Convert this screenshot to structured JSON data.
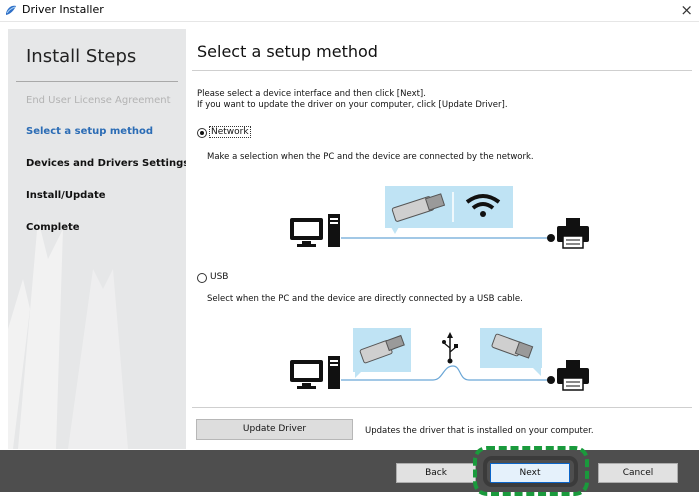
{
  "window": {
    "title": "Driver Installer",
    "close_glyph": "×"
  },
  "sidebar": {
    "heading": "Install Steps",
    "steps": [
      {
        "label": "End User License Agreement",
        "state": "done"
      },
      {
        "label": "Select a setup method",
        "state": "current"
      },
      {
        "label": "Devices and Drivers Settings",
        "state": "pending"
      },
      {
        "label": "Install/Update",
        "state": "pending"
      },
      {
        "label": "Complete",
        "state": "pending"
      }
    ]
  },
  "main": {
    "heading": "Select a setup method",
    "instructions": [
      "Please select a device interface and then click [Next].",
      "If you want to update the driver on your computer, click [Update Driver]."
    ],
    "options": [
      {
        "label": "Network",
        "selected": true,
        "description": "Make a selection when the PC and the device are connected by the network."
      },
      {
        "label": "USB",
        "selected": false,
        "description": "Select when the PC and the device are directly connected by a USB cable."
      }
    ],
    "update_driver_button": "Update Driver",
    "update_driver_description": "Updates the driver that is installed on your computer."
  },
  "footer": {
    "back_label": "Back",
    "next_label": "Next",
    "cancel_label": "Cancel"
  },
  "colors": {
    "accent": "#2b6cb5",
    "illustration_bg": "#bfe3f4",
    "highlight_dash": "#1a9a3c",
    "footer_bg": "#4e4e4e"
  }
}
